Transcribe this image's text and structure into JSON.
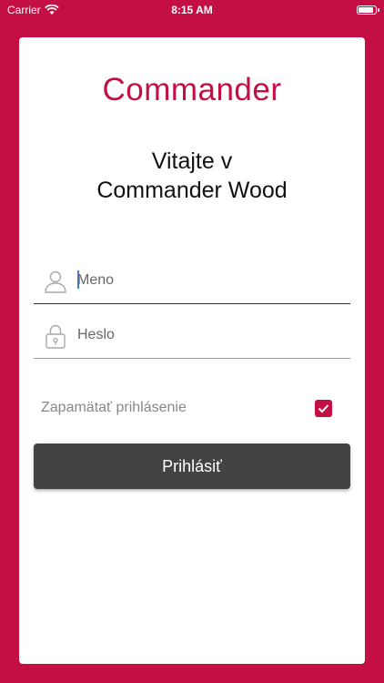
{
  "status_bar": {
    "carrier": "Carrier",
    "time": "8:15 AM",
    "battery_level": 1.0
  },
  "app": {
    "logo_text": "Commander",
    "welcome_line1": "Vitajte v",
    "welcome_line2": "Commander Wood"
  },
  "login_form": {
    "username_placeholder": "Meno",
    "username_value": "",
    "password_placeholder": "Heslo",
    "password_value": "",
    "remember_label": "Zapamätať prihlásenie",
    "remember_checked": true,
    "submit_label": "Prihlásiť"
  },
  "icons": {
    "username": "person-icon",
    "password": "lock-icon",
    "remember": "checkmark-icon"
  },
  "colors": {
    "brand": "#c40f44",
    "button": "#434343",
    "caret": "#3b78e7"
  }
}
